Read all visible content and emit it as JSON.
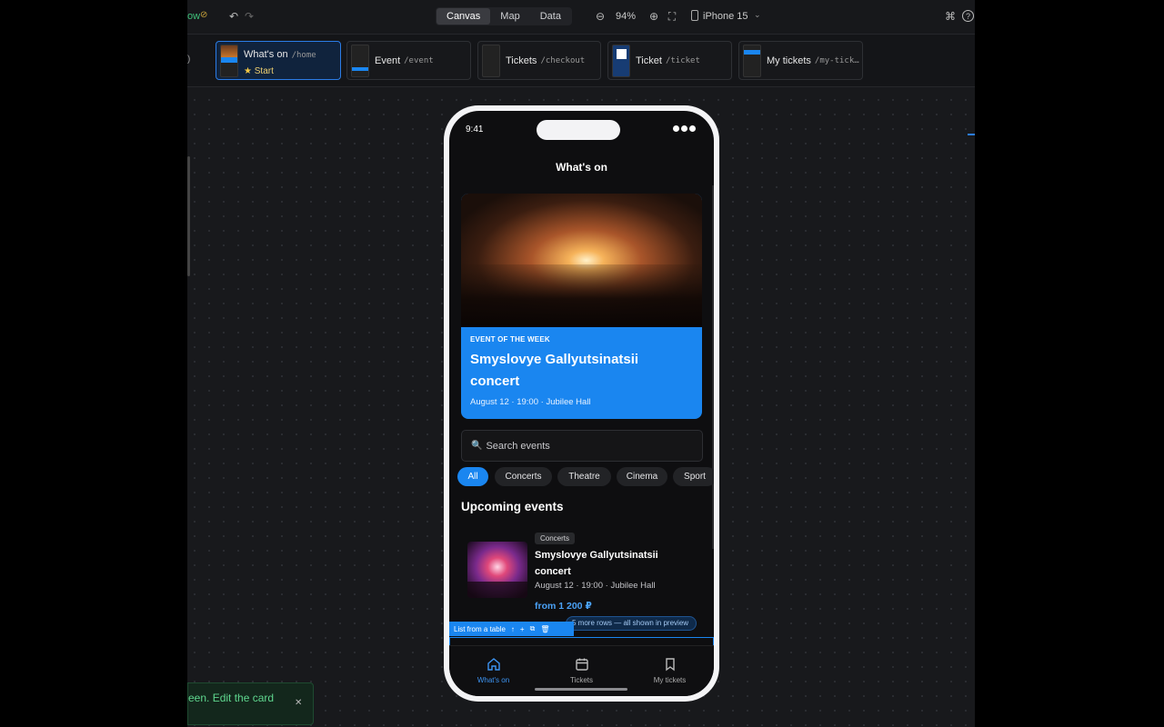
{
  "toolbar": {
    "left_label": "ow",
    "segments": [
      "Canvas",
      "Map",
      "Data"
    ],
    "active_segment": "Canvas",
    "zoom": "94%",
    "device": "iPhone 15",
    "cmd_icon": "⌘",
    "help_icon": "?"
  },
  "routes": [
    {
      "name": "What's on",
      "path": "/home",
      "start_label": "Start",
      "active": true
    },
    {
      "name": "Event",
      "path": "/event"
    },
    {
      "name": "Tickets",
      "path": "/checkout"
    },
    {
      "name": "Ticket",
      "path": "/ticket"
    },
    {
      "name": "My tickets",
      "path": "/my-tick…"
    }
  ],
  "phone": {
    "time": "9:41",
    "title": "What's on",
    "hero": {
      "kicker": "EVENT OF THE WEEK",
      "title_line1": "Smyslovye Gallyutsinatsii",
      "title_line2": "concert",
      "meta": "August 12 · 19:00 · Jubilee Hall"
    },
    "search": {
      "icon": "🔍",
      "placeholder": "Search events"
    },
    "chips": [
      "All",
      "Concerts",
      "Theatre",
      "Cinema",
      "Sport"
    ],
    "section_title": "Upcoming events",
    "event": {
      "badge": "Concerts",
      "title_line1": "Smyslovye Gallyutsinatsii",
      "title_line2": "concert",
      "meta": "August 12 · 19:00 · Jubilee Hall",
      "price": "from 1 200 ₽"
    },
    "list_toolbar": {
      "label": "List from a table",
      "rows_note": "5 more rows — all shown in preview"
    },
    "tabs": [
      {
        "label": "What's on",
        "active": true
      },
      {
        "label": "Tickets"
      },
      {
        "label": "My tickets"
      }
    ]
  },
  "toast": {
    "text": "een. Edit the card",
    "close": "✕"
  },
  "colors": {
    "accent": "#1a86f0",
    "canvas": "#18191c"
  }
}
